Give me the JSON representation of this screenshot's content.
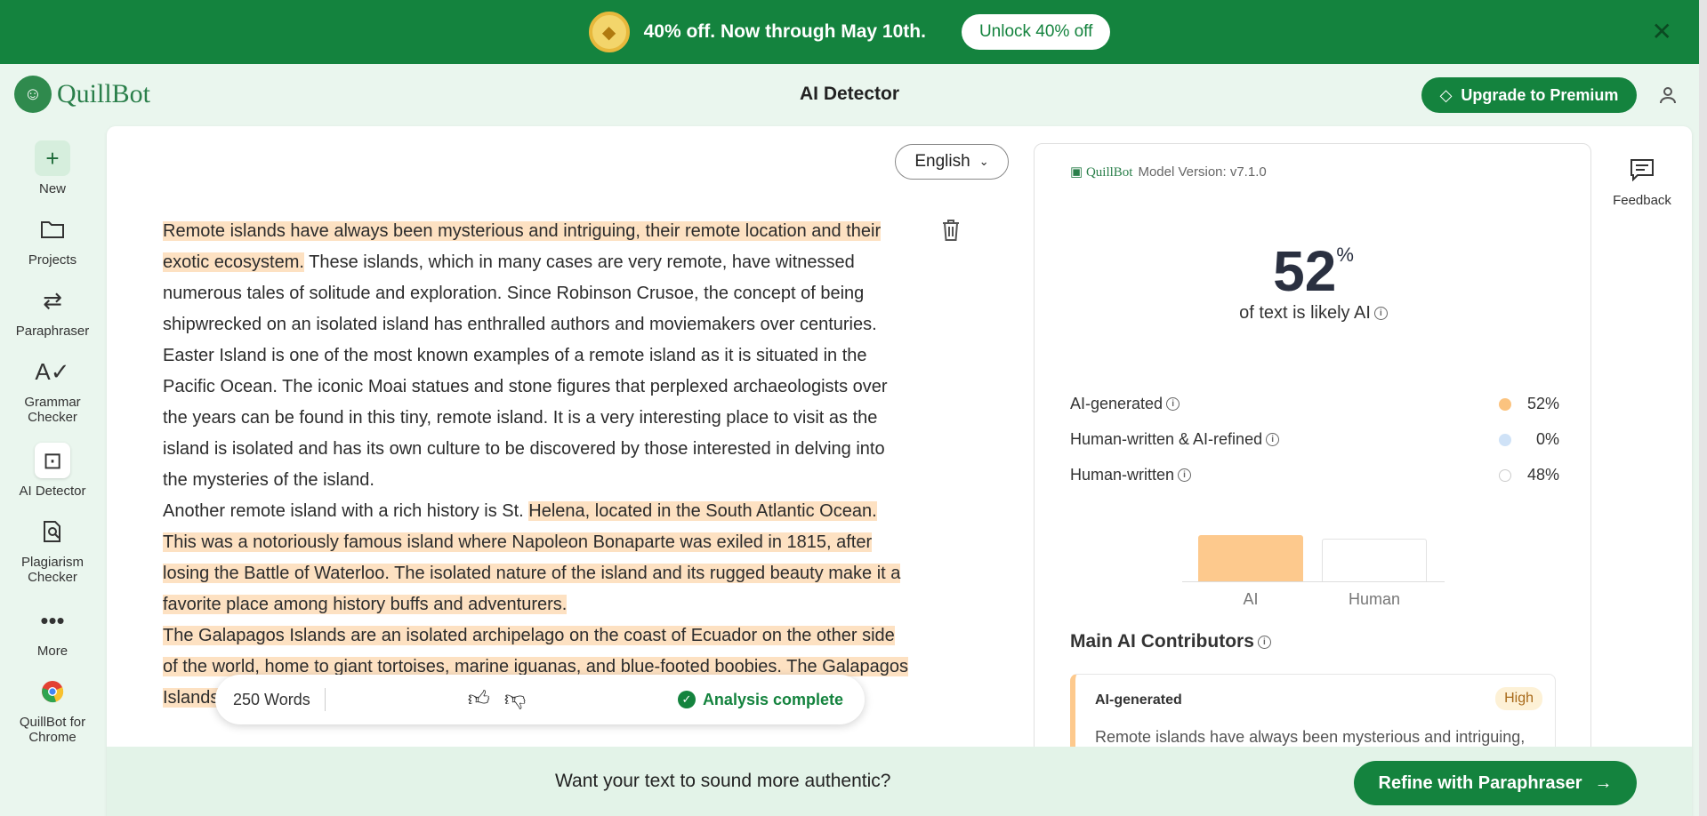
{
  "promo": {
    "text": "40% off. Now through May 10th.",
    "button": "Unlock 40% off",
    "gem_icon": "diamond-badge-icon",
    "close_icon": "close-icon"
  },
  "header": {
    "logo": "QuillBot",
    "title": "AI Detector",
    "upgrade": "Upgrade to Premium",
    "user_icon": "user-icon"
  },
  "sidebar": {
    "items": [
      {
        "label": "New",
        "icon": "plus-icon"
      },
      {
        "label": "Projects",
        "icon": "folder-icon"
      },
      {
        "label": "Paraphraser",
        "icon": "paraphraser-icon"
      },
      {
        "label": "Grammar Checker",
        "icon": "grammar-icon"
      },
      {
        "label": "AI Detector",
        "icon": "ai-detector-icon"
      },
      {
        "label": "Plagiarism Checker",
        "icon": "plagiarism-icon"
      },
      {
        "label": "More",
        "icon": "more-icon"
      },
      {
        "label": "QuillBot for Chrome",
        "icon": "chrome-icon"
      }
    ]
  },
  "editor": {
    "language": "English",
    "paragraphs": [
      [
        {
          "t": "Remote islands have always been mysterious and intriguing, their remote location and their exotic ecosystem.",
          "h": true
        },
        {
          "t": " These islands, which in many cases are very remote, have witnessed numerous tales of solitude and exploration. Since Robinson Crusoe, the concept of being shipwrecked on an isolated island has enthralled authors and moviemakers over centuries.",
          "h": false
        }
      ],
      [
        {
          "t": "Easter Island is one of the most known examples of a remote island as it is situated in the Pacific Ocean. The iconic Moai statues and stone figures that perplexed archaeologists over the years can be found in this tiny, remote island. It is a very interesting place to visit as the island is isolated and has its own culture to be discovered by those interested in delving into the mysteries of the island.",
          "h": false
        }
      ],
      [
        {
          "t": "Another remote island with a rich history is St. ",
          "h": false
        },
        {
          "t": "Helena, located in the South Atlantic Ocean. This was a notoriously famous island where Napoleon Bonaparte was exiled in 1815, after losing the Battle of Waterloo. The isolated nature of the island and its rugged beauty make it a favorite place among history buffs and adventurers.",
          "h": true
        }
      ],
      [
        {
          "t": "The Galapagos Islands are an isolated archipelago on the coast of Ecuador on the other side of the world, home to giant tortoises, marine iguanas, and blue-footed boobies. The Galapagos Islands have been influential in the",
          "h": true
        }
      ]
    ],
    "word_count": "250 Words",
    "status": "Analysis complete"
  },
  "panel": {
    "brand": "QuillBot",
    "model_version": "Model Version: v7.1.0",
    "score": "52",
    "score_unit": "%",
    "score_caption": "of text is likely AI",
    "bar_chart": {
      "ai_fraction": 0.52,
      "human_fraction": 0.48,
      "ai_label": "AI",
      "human_label": "Human"
    },
    "breakdown": [
      {
        "label": "AI-generated",
        "value": "52%",
        "color": "#fbc37f"
      },
      {
        "label": "Human-written & AI-refined",
        "value": "0%",
        "color": "#cfe2f7"
      },
      {
        "label": "Human-written",
        "value": "48%",
        "color": "#ffffff"
      }
    ],
    "contributors_title": "Main AI Contributors",
    "contributor": {
      "label": "AI-generated",
      "level": "High",
      "snippet": "Remote islands have always been mysterious and intriguing,"
    }
  },
  "feedback": {
    "label": "Feedback",
    "icon": "feedback-icon"
  },
  "bottom": {
    "question": "Want your text to sound more authentic?",
    "button": "Refine with Paraphraser"
  },
  "colors": {
    "brand_green": "#14833e",
    "ai_highlight": "#fde1c2",
    "ai_bar": "#fdc98d"
  }
}
